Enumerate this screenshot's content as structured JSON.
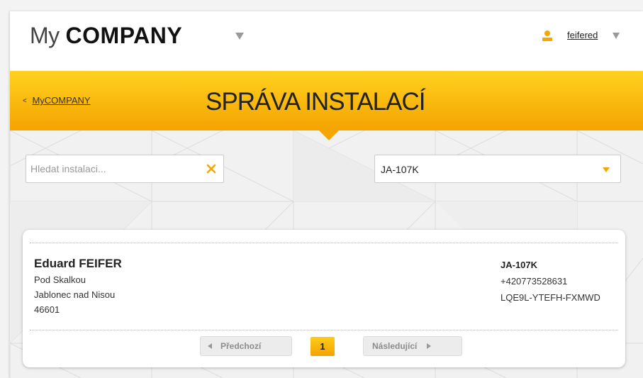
{
  "header": {
    "logo_light": "My",
    "logo_bold": "COMPANY",
    "user_name": "feifered"
  },
  "banner": {
    "back_link": "MyCOMPANY",
    "back_prefix": "<",
    "title": "SPRÁVA INSTALACÍ"
  },
  "filters": {
    "search_placeholder": "Hledat instalaci...",
    "search_value": "",
    "select_value": "JA-107K"
  },
  "installation": {
    "customer_name": "Eduard FEIFER",
    "street": "Pod Skalkou",
    "city": "Jablonec nad Nisou",
    "zip": "46601",
    "device_id": "JA-107K",
    "phone": "+420773528631",
    "reg_code": "LQE9L-YTEFH-FXMWD"
  },
  "pagination": {
    "prev_label": "Předchozí",
    "current_page": "1",
    "next_label": "Následující"
  },
  "colors": {
    "accent": "#f5a600",
    "accent_light": "#ffd21f"
  },
  "icons": {
    "user": "user-icon",
    "clear": "close-icon",
    "dropdown": "chevron-down-icon"
  }
}
